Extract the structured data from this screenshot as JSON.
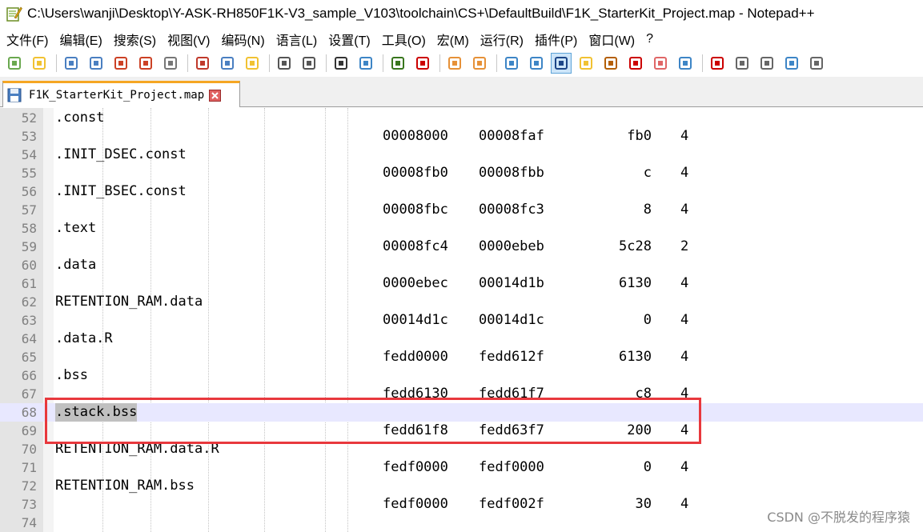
{
  "window": {
    "title": "C:\\Users\\wanji\\Desktop\\Y-ASK-RH850F1K-V3_sample_V103\\toolchain\\CS+\\DefaultBuild\\F1K_StarterKit_Project.map - Notepad++"
  },
  "menu": [
    {
      "label": "文件(F)"
    },
    {
      "label": "编辑(E)"
    },
    {
      "label": "搜索(S)"
    },
    {
      "label": "视图(V)"
    },
    {
      "label": "编码(N)"
    },
    {
      "label": "语言(L)"
    },
    {
      "label": "设置(T)"
    },
    {
      "label": "工具(O)"
    },
    {
      "label": "宏(M)"
    },
    {
      "label": "运行(R)"
    },
    {
      "label": "插件(P)"
    },
    {
      "label": "窗口(W)"
    },
    {
      "label": "?"
    }
  ],
  "toolbar": {
    "icons": [
      "new-file-icon",
      "open-file-icon",
      "save-icon",
      "save-all-icon",
      "close-icon",
      "close-all-icon",
      "print-icon",
      "cut-icon",
      "copy-icon",
      "paste-icon",
      "undo-icon",
      "redo-icon",
      "find-icon",
      "replace-icon",
      "zoom-in-icon",
      "zoom-out-icon",
      "sync-vertical-icon",
      "sync-horizontal-icon",
      "word-wrap-icon",
      "show-all-chars-icon",
      "indent-guide-icon",
      "user-language-icon",
      "doc-map-icon",
      "function-list-icon",
      "folder-workspace-icon",
      "monitoring-icon",
      "record-macro-icon",
      "stop-record-icon",
      "play-macro-icon",
      "run-macro-multiple-icon",
      "save-macro-icon"
    ]
  },
  "tab": {
    "label": "F1K_StarterKit_Project.map"
  },
  "lines": [
    {
      "num": "52",
      "section": ".const"
    },
    {
      "num": "53",
      "start": "00008000",
      "end": "00008faf",
      "size": "fb0",
      "align": "4"
    },
    {
      "num": "54",
      "section": ".INIT_DSEC.const"
    },
    {
      "num": "55",
      "start": "00008fb0",
      "end": "00008fbb",
      "size": "c",
      "align": "4"
    },
    {
      "num": "56",
      "section": ".INIT_BSEC.const"
    },
    {
      "num": "57",
      "start": "00008fbc",
      "end": "00008fc3",
      "size": "8",
      "align": "4"
    },
    {
      "num": "58",
      "section": ".text"
    },
    {
      "num": "59",
      "start": "00008fc4",
      "end": "0000ebeb",
      "size": "5c28",
      "align": "2"
    },
    {
      "num": "60",
      "section": ".data"
    },
    {
      "num": "61",
      "start": "0000ebec",
      "end": "00014d1b",
      "size": "6130",
      "align": "4"
    },
    {
      "num": "62",
      "section": "RETENTION_RAM.data"
    },
    {
      "num": "63",
      "start": "00014d1c",
      "end": "00014d1c",
      "size": "0",
      "align": "4"
    },
    {
      "num": "64",
      "section": ".data.R"
    },
    {
      "num": "65",
      "start": "fedd0000",
      "end": "fedd612f",
      "size": "6130",
      "align": "4"
    },
    {
      "num": "66",
      "section": ".bss"
    },
    {
      "num": "67",
      "start": "fedd6130",
      "end": "fedd61f7",
      "size": "c8",
      "align": "4"
    },
    {
      "num": "68",
      "section": ".stack.bss"
    },
    {
      "num": "69",
      "start": "fedd61f8",
      "end": "fedd63f7",
      "size": "200",
      "align": "4"
    },
    {
      "num": "70",
      "section": "RETENTION_RAM.data.R"
    },
    {
      "num": "71",
      "start": "fedf0000",
      "end": "fedf0000",
      "size": "0",
      "align": "4"
    },
    {
      "num": "72",
      "section": "RETENTION_RAM.bss"
    },
    {
      "num": "73",
      "start": "fedf0000",
      "end": "fedf002f",
      "size": "30",
      "align": "4"
    },
    {
      "num": "74"
    }
  ],
  "watermark": "CSDN @不脱发的程序猿"
}
